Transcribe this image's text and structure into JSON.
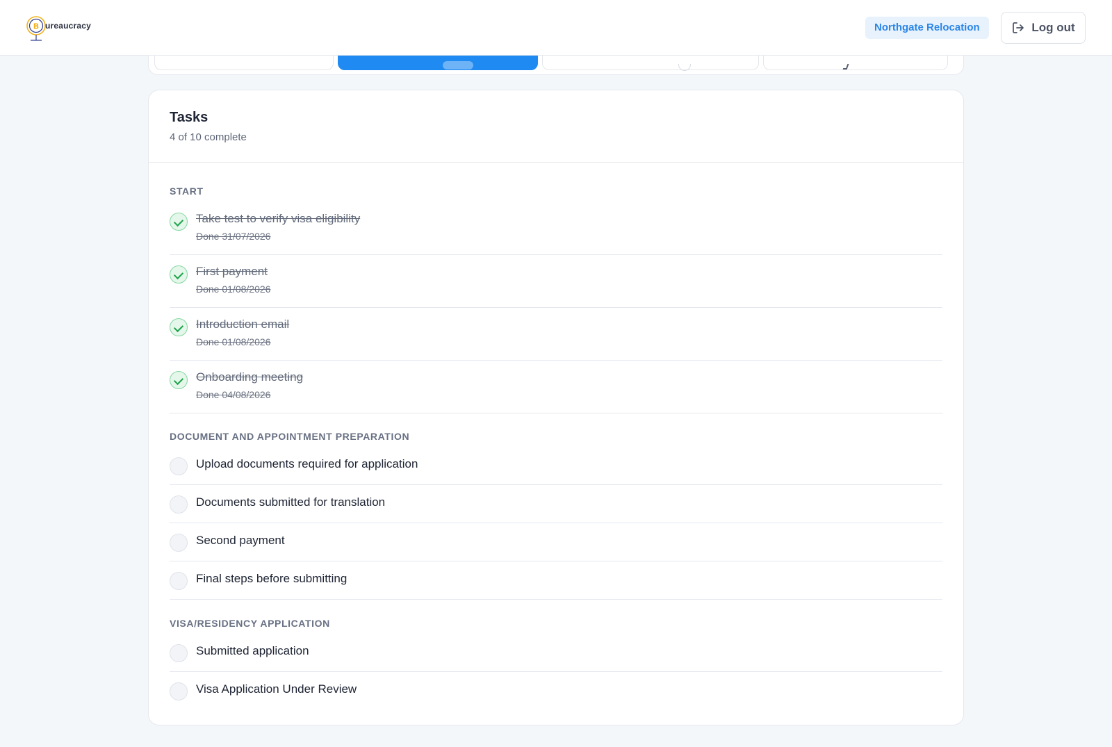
{
  "header": {
    "logo_text": "ureaucracy",
    "org_name": "Northgate Relocation",
    "logout_label": "Log out"
  },
  "tasks": {
    "title": "Tasks",
    "summary": "4 of 10 complete",
    "sections": [
      {
        "title": "START",
        "items": [
          {
            "label": "Take test to verify visa eligibility",
            "status": "done",
            "date": "Done 31/07/2026"
          },
          {
            "label": "First payment",
            "status": "done",
            "date": "Done 01/08/2026"
          },
          {
            "label": "Introduction email",
            "status": "done",
            "date": "Done 01/08/2026"
          },
          {
            "label": "Onboarding meeting",
            "status": "done",
            "date": "Done 04/08/2026"
          }
        ]
      },
      {
        "title": "DOCUMENT AND APPOINTMENT PREPARATION",
        "items": [
          {
            "label": "Upload documents required for application",
            "status": "todo"
          },
          {
            "label": "Documents submitted for translation",
            "status": "todo"
          },
          {
            "label": "Second payment",
            "status": "todo"
          },
          {
            "label": "Final steps before submitting",
            "status": "todo"
          }
        ]
      },
      {
        "title": "VISA/RESIDENCY APPLICATION",
        "items": [
          {
            "label": "Submitted application",
            "status": "todo"
          },
          {
            "label": "Visa Application Under Review",
            "status": "todo"
          }
        ]
      }
    ]
  },
  "colors": {
    "accent": "#1f8af2",
    "done_green": "#1fa34a",
    "badge_bg": "#e7f2fd",
    "badge_text": "#2a86e6"
  }
}
